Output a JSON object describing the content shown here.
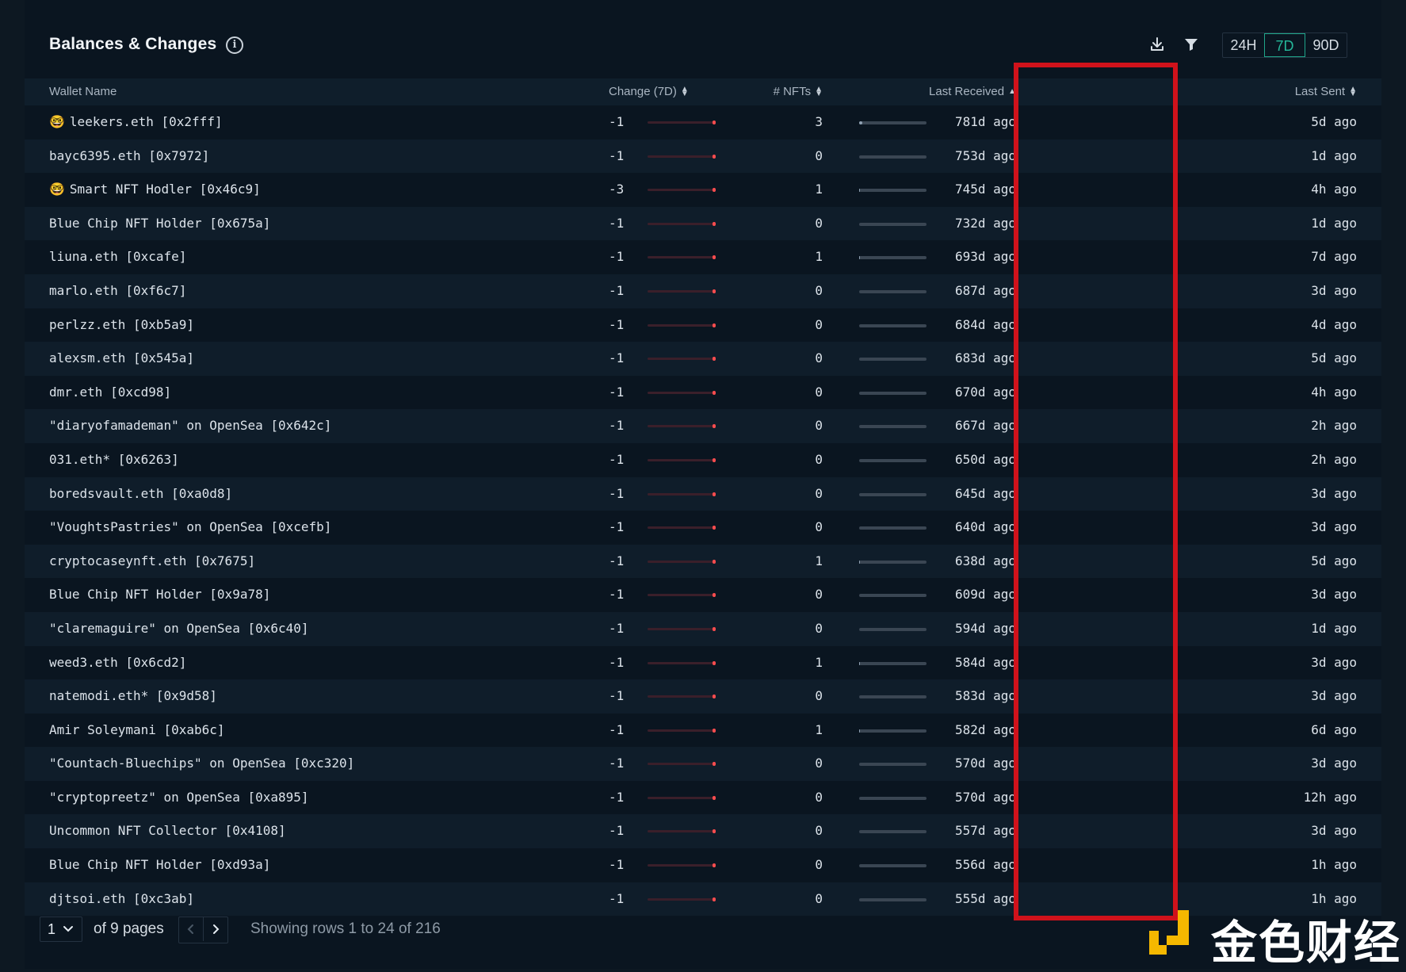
{
  "header": {
    "title": "Balances & Changes",
    "time_ranges": [
      "24H",
      "7D",
      "90D"
    ],
    "selected_range": "7D"
  },
  "table": {
    "columns": {
      "wallet": "Wallet Name",
      "change": "Change (7D)",
      "nfts": "# NFTs",
      "last_received": "Last Received",
      "last_sent": "Last Sent"
    },
    "rows": [
      {
        "nerd": true,
        "wallet": "leekers.eth [0x2fff]",
        "change": "-1",
        "nfts": "3",
        "received": "781d ago",
        "sent": "5d ago"
      },
      {
        "nerd": false,
        "wallet": "bayc6395.eth [0x7972]",
        "change": "-1",
        "nfts": "0",
        "received": "753d ago",
        "sent": "1d ago"
      },
      {
        "nerd": true,
        "wallet": "Smart NFT Hodler [0x46c9]",
        "change": "-3",
        "nfts": "1",
        "received": "745d ago",
        "sent": "4h ago"
      },
      {
        "nerd": false,
        "wallet": "Blue Chip NFT Holder [0x675a]",
        "change": "-1",
        "nfts": "0",
        "received": "732d ago",
        "sent": "1d ago"
      },
      {
        "nerd": false,
        "wallet": "liuna.eth [0xcafe]",
        "change": "-1",
        "nfts": "1",
        "received": "693d ago",
        "sent": "7d ago"
      },
      {
        "nerd": false,
        "wallet": "marlo.eth [0xf6c7]",
        "change": "-1",
        "nfts": "0",
        "received": "687d ago",
        "sent": "3d ago"
      },
      {
        "nerd": false,
        "wallet": "perlzz.eth [0xb5a9]",
        "change": "-1",
        "nfts": "0",
        "received": "684d ago",
        "sent": "4d ago"
      },
      {
        "nerd": false,
        "wallet": "alexsm.eth [0x545a]",
        "change": "-1",
        "nfts": "0",
        "received": "683d ago",
        "sent": "5d ago"
      },
      {
        "nerd": false,
        "wallet": "dmr.eth [0xcd98]",
        "change": "-1",
        "nfts": "0",
        "received": "670d ago",
        "sent": "4h ago"
      },
      {
        "nerd": false,
        "wallet": "\"diaryofamademan\" on OpenSea [0x642c]",
        "change": "-1",
        "nfts": "0",
        "received": "667d ago",
        "sent": "2h ago"
      },
      {
        "nerd": false,
        "wallet": "031.eth* [0x6263]",
        "change": "-1",
        "nfts": "0",
        "received": "650d ago",
        "sent": "2h ago"
      },
      {
        "nerd": false,
        "wallet": "boredsvault.eth [0xa0d8]",
        "change": "-1",
        "nfts": "0",
        "received": "645d ago",
        "sent": "3d ago"
      },
      {
        "nerd": false,
        "wallet": "\"VoughtsPastries\" on OpenSea [0xcefb]",
        "change": "-1",
        "nfts": "0",
        "received": "640d ago",
        "sent": "3d ago"
      },
      {
        "nerd": false,
        "wallet": "cryptocaseynft.eth [0x7675]",
        "change": "-1",
        "nfts": "1",
        "received": "638d ago",
        "sent": "5d ago"
      },
      {
        "nerd": false,
        "wallet": "Blue Chip NFT Holder [0x9a78]",
        "change": "-1",
        "nfts": "0",
        "received": "609d ago",
        "sent": "3d ago"
      },
      {
        "nerd": false,
        "wallet": "\"claremaguire\" on OpenSea [0x6c40]",
        "change": "-1",
        "nfts": "0",
        "received": "594d ago",
        "sent": "1d ago"
      },
      {
        "nerd": false,
        "wallet": "weed3.eth [0x6cd2]",
        "change": "-1",
        "nfts": "1",
        "received": "584d ago",
        "sent": "3d ago"
      },
      {
        "nerd": false,
        "wallet": "natemodi.eth* [0x9d58]",
        "change": "-1",
        "nfts": "0",
        "received": "583d ago",
        "sent": "3d ago"
      },
      {
        "nerd": false,
        "wallet": "Amir Soleymani [0xab6c]",
        "change": "-1",
        "nfts": "1",
        "received": "582d ago",
        "sent": "6d ago"
      },
      {
        "nerd": false,
        "wallet": "\"Countach-Bluechips\" on OpenSea [0xc320]",
        "change": "-1",
        "nfts": "0",
        "received": "570d ago",
        "sent": "3d ago"
      },
      {
        "nerd": false,
        "wallet": "\"cryptopreetz\" on OpenSea [0xa895]",
        "change": "-1",
        "nfts": "0",
        "received": "570d ago",
        "sent": "12h ago"
      },
      {
        "nerd": false,
        "wallet": "Uncommon NFT Collector [0x4108]",
        "change": "-1",
        "nfts": "0",
        "received": "557d ago",
        "sent": "3d ago"
      },
      {
        "nerd": false,
        "wallet": "Blue Chip NFT Holder [0xd93a]",
        "change": "-1",
        "nfts": "0",
        "received": "556d ago",
        "sent": "1h ago"
      },
      {
        "nerd": false,
        "wallet": "djtsoi.eth [0xc3ab]",
        "change": "-1",
        "nfts": "0",
        "received": "555d ago",
        "sent": "1h ago"
      }
    ]
  },
  "pagination": {
    "current_page": "1",
    "of_pages": "of 9 pages",
    "showing": "Showing rows 1 to 24 of 216"
  },
  "watermark": {
    "text": "金色财经"
  },
  "colors": {
    "background": "#0a1520",
    "accent": "#1fa58a",
    "highlight_box": "#d0121b",
    "negative": "#ff4d4f"
  }
}
